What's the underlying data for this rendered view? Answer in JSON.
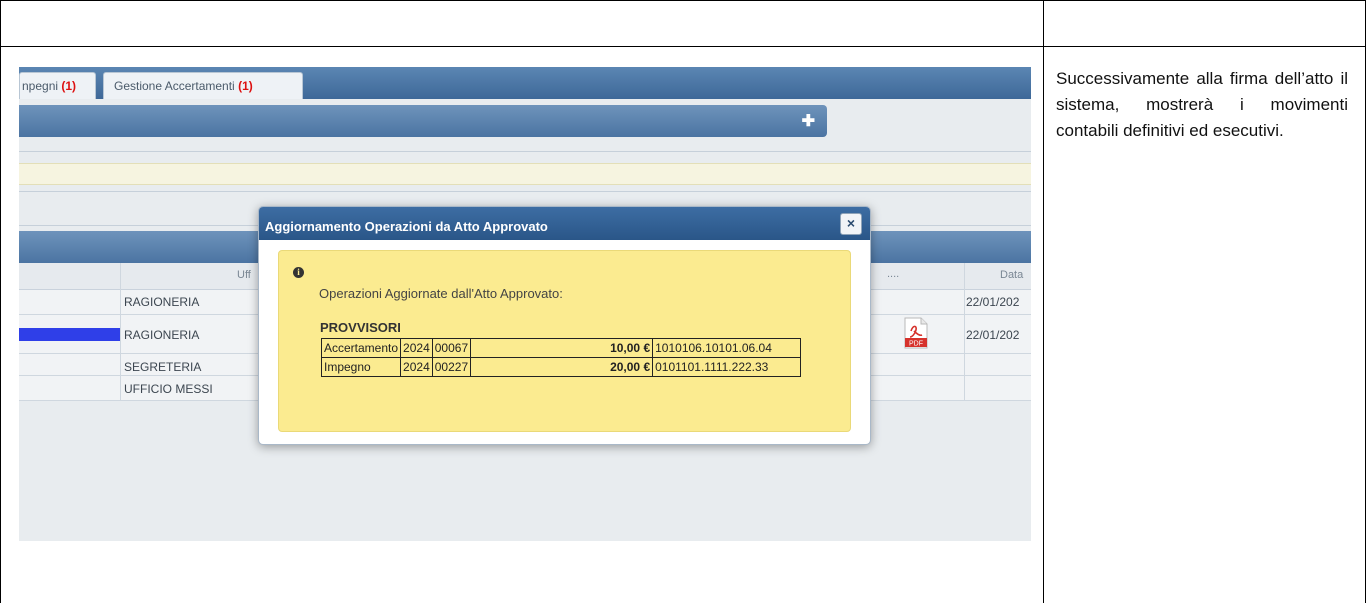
{
  "tabs": [
    {
      "label": "npegni",
      "count": "(1)"
    },
    {
      "label": "Gestione Accertamenti",
      "count": "(1)"
    }
  ],
  "panel": {
    "plus_icon": "plus-icon"
  },
  "grid": {
    "headers": {
      "ufficio": "Uff",
      "pdf": "....",
      "data": "Data"
    },
    "rows": [
      {
        "ufficio": "RAGIONERIA",
        "data": "22/01/202"
      },
      {
        "ufficio": "RAGIONERIA",
        "data": "22/01/202",
        "has_pdf": true
      },
      {
        "ufficio": "SEGRETERIA",
        "data": ""
      },
      {
        "ufficio": "UFFICIO MESSI",
        "data": ""
      }
    ],
    "pdf_label": "PDF"
  },
  "modal": {
    "title": "Aggiornamento Operazioni da Atto Approvato",
    "close_label": "×",
    "message": "Operazioni Aggiornate dall'Atto Approvato:",
    "section_title": "PROVVISORI",
    "operations": [
      {
        "tipo": "Accertamento",
        "anno": "2024",
        "numero": "00067",
        "importo": "10,00 €",
        "codice": "1010106.10101.06.04"
      },
      {
        "tipo": "Impegno",
        "anno": "2024",
        "numero": "00227",
        "importo": "20,00 €",
        "codice": "0101101.1111.222.33"
      }
    ]
  },
  "side_text": "Successivamente alla firma dell’atto il sistema, mostrerà i movimenti contabili definitivi ed esecutivi.",
  "colors": {
    "title_bar": "#2a5688",
    "message_bg": "#fbeb90",
    "count": "#dd1111",
    "selection": "#2f3fe8"
  }
}
